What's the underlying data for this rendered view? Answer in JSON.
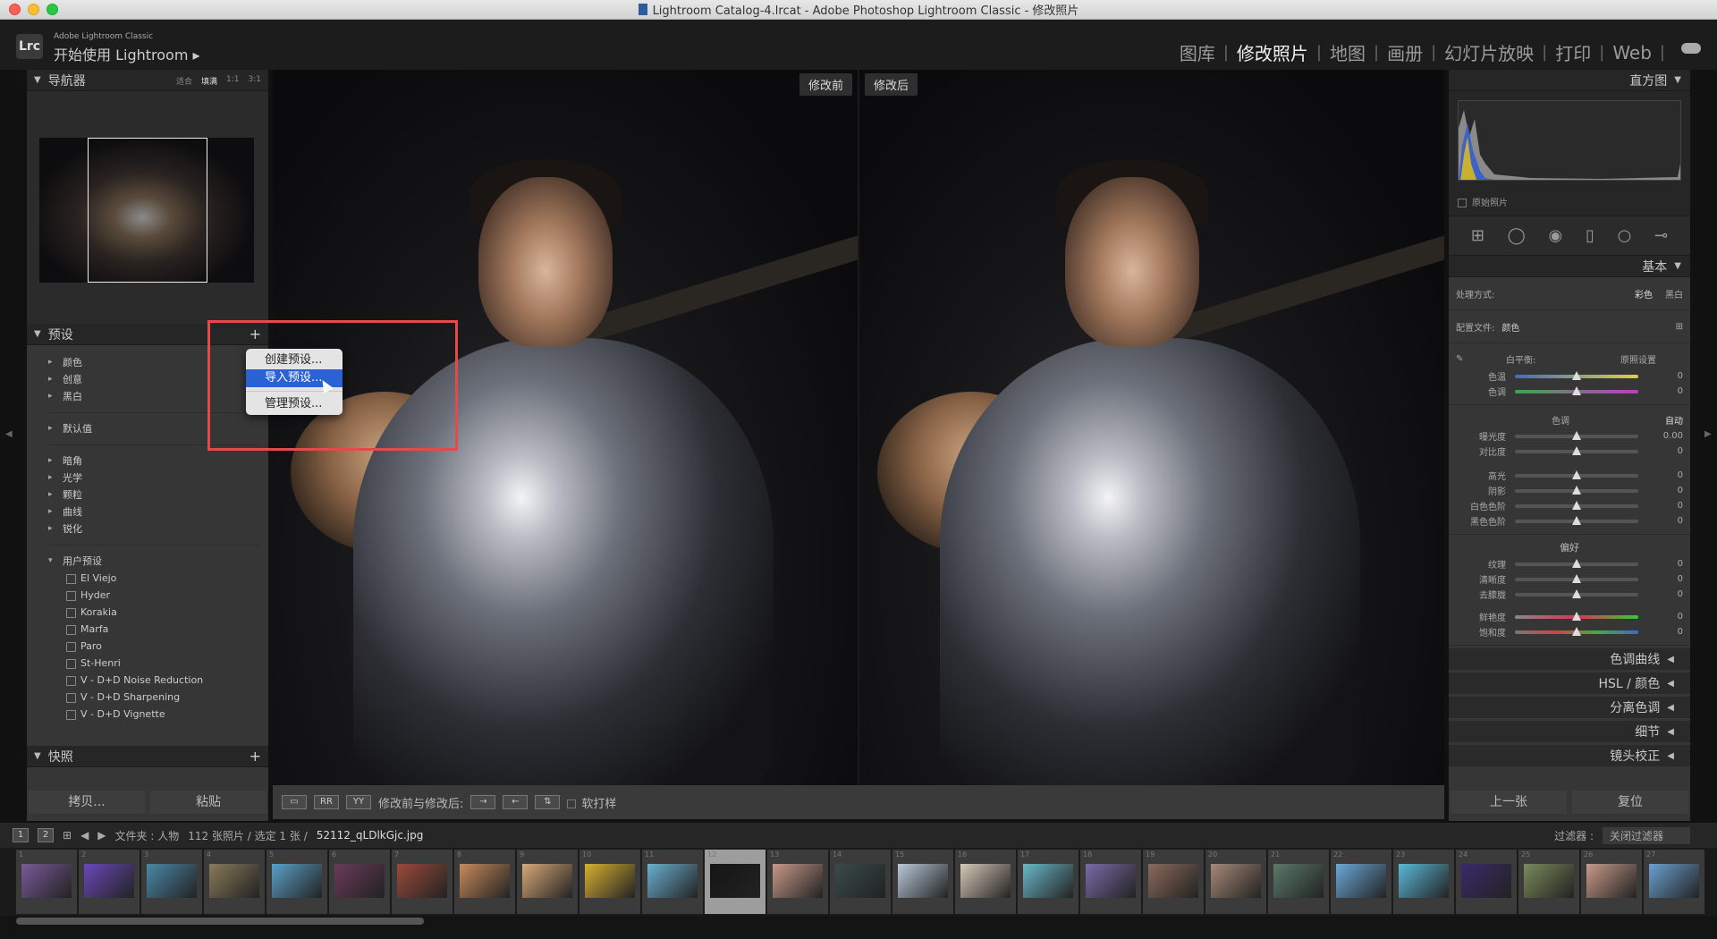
{
  "window": {
    "title": "Lightroom Catalog-4.lrcat - Adobe Photoshop Lightroom Classic - 修改照片"
  },
  "identity": {
    "logo": "Lrc",
    "subtitle": "Adobe Lightroom Classic",
    "main": "开始使用 Lightroom",
    "arrow": "▸"
  },
  "modules": [
    "图库",
    "修改照片",
    "地图",
    "画册",
    "幻灯片放映",
    "打印",
    "Web"
  ],
  "navigator": {
    "title": "导航器",
    "options": [
      "适合",
      "填满",
      "1:1",
      "3:1"
    ]
  },
  "presets": {
    "title": "预设",
    "groups1": [
      "颜色",
      "创意",
      "黑白"
    ],
    "groups2": [
      "默认值"
    ],
    "groups3": [
      "暗角",
      "光学",
      "颗粒",
      "曲线",
      "锐化"
    ],
    "user_title": "用户预设",
    "user_items": [
      "El Viejo",
      "Hyder",
      "Korakia",
      "Marfa",
      "Paro",
      "St-Henri",
      "V - D+D Noise Reduction",
      "V - D+D Sharpening",
      "V - D+D Vignette"
    ]
  },
  "snapshots": {
    "title": "快照"
  },
  "context_menu": {
    "create": "创建预设...",
    "import": "导入预设...",
    "manage": "管理预设..."
  },
  "left_buttons": {
    "copy": "拷贝...",
    "paste": "粘贴"
  },
  "compare": {
    "before": "修改前",
    "after": "修改后"
  },
  "toolbar": {
    "view1": "▭",
    "view2": "RR",
    "view3": "YY",
    "label": "修改前与修改后:",
    "softproof": "软打样"
  },
  "histogram": {
    "title": "直方图",
    "original": "原始照片"
  },
  "basic": {
    "title": "基本",
    "treatment_label": "处理方式:",
    "treatment_color": "彩色",
    "treatment_bw": "黑白",
    "profile_label": "配置文件:",
    "profile_value": "颜色",
    "wb_label": "白平衡:",
    "wb_value": "原照设置",
    "tone_label": "色调",
    "auto": "自动",
    "presence_label": "偏好",
    "wb_sliders": [
      {
        "label": "色温",
        "value": "0"
      },
      {
        "label": "色调",
        "value": "0"
      }
    ],
    "tone_sliders": [
      {
        "label": "曝光度",
        "value": "0.00"
      },
      {
        "label": "对比度",
        "value": "0"
      }
    ],
    "tone_sliders2": [
      {
        "label": "高光",
        "value": "0"
      },
      {
        "label": "阴影",
        "value": "0"
      },
      {
        "label": "白色色阶",
        "value": "0"
      },
      {
        "label": "黑色色阶",
        "value": "0"
      }
    ],
    "presence_sliders": [
      {
        "label": "纹理",
        "value": "0"
      },
      {
        "label": "清晰度",
        "value": "0"
      },
      {
        "label": "去朦胧",
        "value": "0"
      }
    ],
    "presence_sliders2": [
      {
        "label": "鲜艳度",
        "value": "0"
      },
      {
        "label": "饱和度",
        "value": "0"
      }
    ]
  },
  "collapsed_panels": [
    "色调曲线",
    "HSL / 颜色",
    "分离色调",
    "细节",
    "镜头校正"
  ],
  "right_buttons": {
    "prev": "上一张",
    "reset": "复位"
  },
  "filmstrip": {
    "screens": [
      "1",
      "2"
    ],
    "source": "文件夹 : 人物",
    "count": "112 张照片 / 选定 1 张 /",
    "filename": "52112_qLDlkGjc.jpg",
    "filter_label": "过滤器 :",
    "filter_value": "关闭过滤器",
    "numbers": [
      "1",
      "2",
      "3",
      "4",
      "5",
      "6",
      "7",
      "8",
      "9",
      "10",
      "11",
      "12",
      "13",
      "14",
      "15",
      "16",
      "17",
      "18",
      "19",
      "20",
      "21",
      "22",
      "23",
      "24",
      "25",
      "26",
      "27"
    ]
  }
}
